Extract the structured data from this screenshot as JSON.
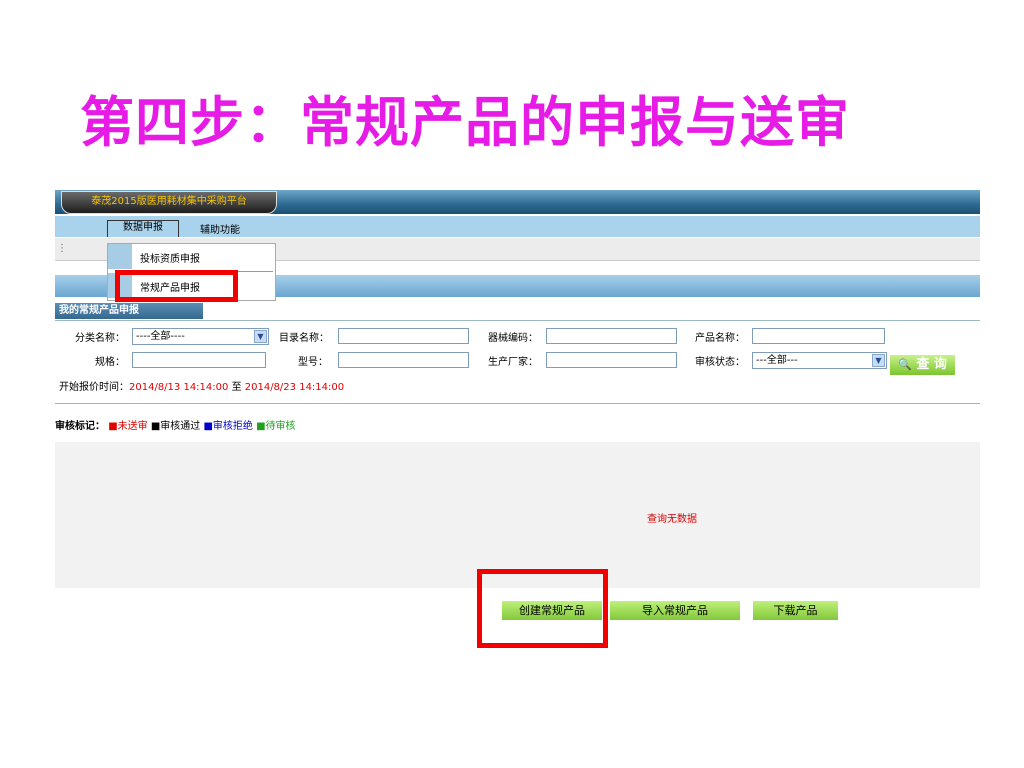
{
  "slide": {
    "title": "第四步：常规产品的申报与送审"
  },
  "app": {
    "brand": "泰茂2015版医用耗材集中采购平台",
    "nav": {
      "data_report": "数据申报",
      "assist": "辅助功能"
    },
    "dropdown": {
      "item1": "投标资质申报",
      "item2": "常规产品申报"
    },
    "section_title": "我的常规产品申报",
    "filters": {
      "category_label": "分类名称：",
      "category_value": "----全部----",
      "catalog_label": "目录名称：",
      "device_code_label": "器械编码：",
      "product_name_label": "产品名称：",
      "spec_label": "规格：",
      "model_label": "型号：",
      "manufacturer_label": "生产厂家：",
      "audit_status_label": "审核状态：",
      "audit_status_value": "---全部---",
      "time_label": "开始报价时间：",
      "time_from": "2014/8/13 14:14:00",
      "time_to_label": "至",
      "time_to": "2014/8/23 14:14:00",
      "query_button": "查 询"
    },
    "legend": {
      "label": "审核标记：",
      "not_sent": "未送审",
      "approved": "审核通过",
      "rejected": "审核拒绝",
      "pending": "待审核",
      "colors": {
        "not_sent": "#e00000",
        "approved": "#000000",
        "rejected": "#0000cc",
        "pending": "#22a022"
      }
    },
    "results": {
      "empty_text": "查询无数据"
    },
    "buttons": {
      "create": "创建常规产品",
      "import": "导入常规产品",
      "download": "下载产品"
    }
  }
}
